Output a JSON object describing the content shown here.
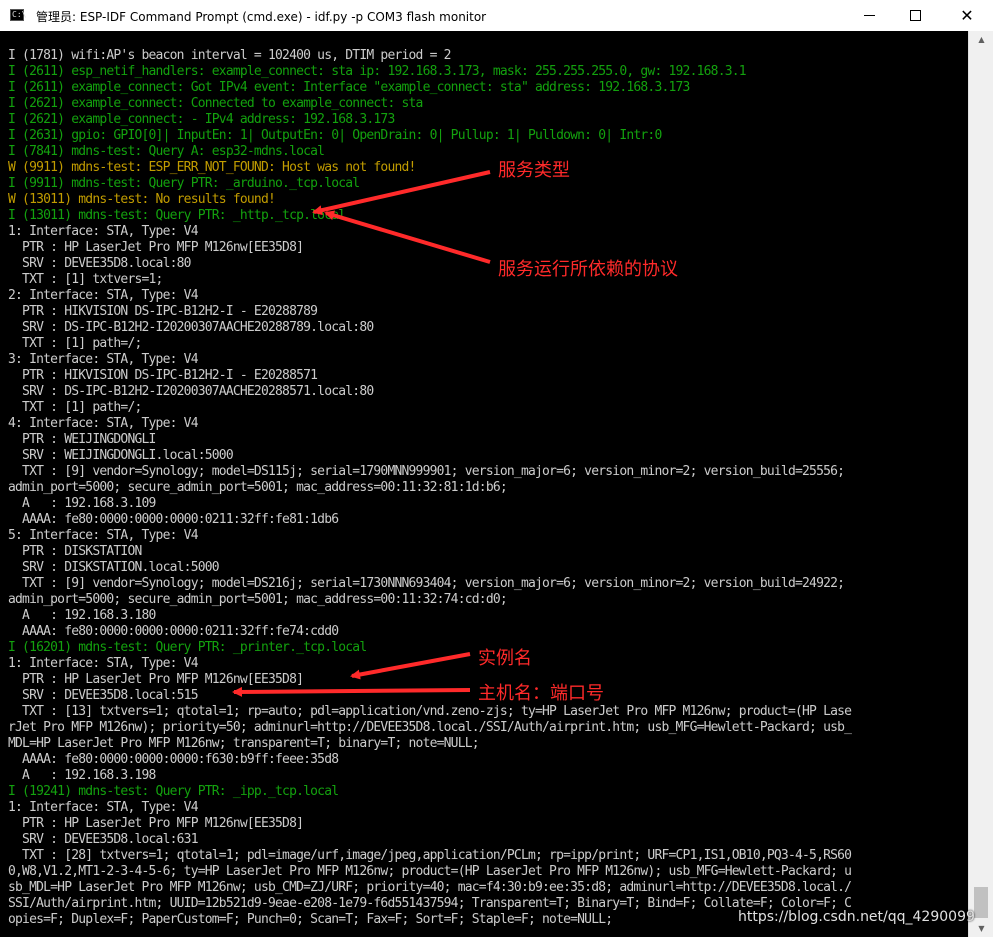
{
  "window": {
    "icon_text": "C:\\",
    "title": "管理员: ESP-IDF Command Prompt (cmd.exe) - idf.py  -p COM3 flash monitor",
    "close_label": "✕"
  },
  "scrollbar": {
    "up_arrow": "▲",
    "down_arrow": "▼"
  },
  "colors": {
    "green": "#13a10e",
    "yellow": "#c19c00",
    "plain": "#cccccc",
    "annotation": "#ff2a2a"
  },
  "console_lines": [
    {
      "style": "plain",
      "text": "I (1781) wifi:AP's beacon interval = 102400 us, DTIM period = 2"
    },
    {
      "style": "green",
      "text": "I (2611) esp_netif_handlers: example_connect: sta ip: 192.168.3.173, mask: 255.255.255.0, gw: 192.168.3.1"
    },
    {
      "style": "green",
      "text": "I (2611) example_connect: Got IPv4 event: Interface \"example_connect: sta\" address: 192.168.3.173"
    },
    {
      "style": "green",
      "text": "I (2621) example_connect: Connected to example_connect: sta"
    },
    {
      "style": "green",
      "text": "I (2621) example_connect: - IPv4 address: 192.168.3.173"
    },
    {
      "style": "green",
      "text": "I (2631) gpio: GPIO[0]| InputEn: 1| OutputEn: 0| OpenDrain: 0| Pullup: 1| Pulldown: 0| Intr:0"
    },
    {
      "style": "green",
      "text": "I (7841) mdns-test: Query A: esp32-mdns.local"
    },
    {
      "style": "yellow",
      "text": "W (9911) mdns-test: ESP_ERR_NOT_FOUND: Host was not found!"
    },
    {
      "style": "green",
      "text": "I (9911) mdns-test: Query PTR: _arduino._tcp.local"
    },
    {
      "style": "yellow",
      "text": "W (13011) mdns-test: No results found!"
    },
    {
      "style": "green",
      "text": "I (13011) mdns-test: Query PTR: _http._tcp.local"
    },
    {
      "style": "plain",
      "text": "1: Interface: STA, Type: V4"
    },
    {
      "style": "plain",
      "text": "  PTR : HP LaserJet Pro MFP M126nw[EE35D8]"
    },
    {
      "style": "plain",
      "text": "  SRV : DEVEE35D8.local:80"
    },
    {
      "style": "plain",
      "text": "  TXT : [1] txtvers=1;"
    },
    {
      "style": "plain",
      "text": "2: Interface: STA, Type: V4"
    },
    {
      "style": "plain",
      "text": "  PTR : HIKVISION DS-IPC-B12H2-I - E20288789"
    },
    {
      "style": "plain",
      "text": "  SRV : DS-IPC-B12H2-I20200307AACHE20288789.local:80"
    },
    {
      "style": "plain",
      "text": "  TXT : [1] path=/;"
    },
    {
      "style": "plain",
      "text": "3: Interface: STA, Type: V4"
    },
    {
      "style": "plain",
      "text": "  PTR : HIKVISION DS-IPC-B12H2-I - E20288571"
    },
    {
      "style": "plain",
      "text": "  SRV : DS-IPC-B12H2-I20200307AACHE20288571.local:80"
    },
    {
      "style": "plain",
      "text": "  TXT : [1] path=/;"
    },
    {
      "style": "plain",
      "text": "4: Interface: STA, Type: V4"
    },
    {
      "style": "plain",
      "text": "  PTR : WEIJINGDONGLI"
    },
    {
      "style": "plain",
      "text": "  SRV : WEIJINGDONGLI.local:5000"
    },
    {
      "style": "plain",
      "text": "  TXT : [9] vendor=Synology; model=DS115j; serial=1790MNN999901; version_major=6; version_minor=2; version_build=25556;"
    },
    {
      "style": "plain",
      "text": "admin_port=5000; secure_admin_port=5001; mac_address=00:11:32:81:1d:b6;"
    },
    {
      "style": "plain",
      "text": "  A   : 192.168.3.109"
    },
    {
      "style": "plain",
      "text": "  AAAA: fe80:0000:0000:0000:0211:32ff:fe81:1db6"
    },
    {
      "style": "plain",
      "text": "5: Interface: STA, Type: V4"
    },
    {
      "style": "plain",
      "text": "  PTR : DISKSTATION"
    },
    {
      "style": "plain",
      "text": "  SRV : DISKSTATION.local:5000"
    },
    {
      "style": "plain",
      "text": "  TXT : [9] vendor=Synology; model=DS216j; serial=1730NNN693404; version_major=6; version_minor=2; version_build=24922;"
    },
    {
      "style": "plain",
      "text": "admin_port=5000; secure_admin_port=5001; mac_address=00:11:32:74:cd:d0;"
    },
    {
      "style": "plain",
      "text": "  A   : 192.168.3.180"
    },
    {
      "style": "plain",
      "text": "  AAAA: fe80:0000:0000:0000:0211:32ff:fe74:cdd0"
    },
    {
      "style": "green",
      "text": "I (16201) mdns-test: Query PTR: _printer._tcp.local"
    },
    {
      "style": "plain",
      "text": "1: Interface: STA, Type: V4"
    },
    {
      "style": "plain",
      "text": "  PTR : HP LaserJet Pro MFP M126nw[EE35D8]"
    },
    {
      "style": "plain",
      "text": "  SRV : DEVEE35D8.local:515"
    },
    {
      "style": "plain",
      "text": "  TXT : [13] txtvers=1; qtotal=1; rp=auto; pdl=application/vnd.zeno-zjs; ty=HP LaserJet Pro MFP M126nw; product=(HP Lase"
    },
    {
      "style": "plain",
      "text": "rJet Pro MFP M126nw); priority=50; adminurl=http://DEVEE35D8.local./SSI/Auth/airprint.htm; usb_MFG=Hewlett-Packard; usb_"
    },
    {
      "style": "plain",
      "text": "MDL=HP LaserJet Pro MFP M126nw; transparent=T; binary=T; note=NULL;"
    },
    {
      "style": "plain",
      "text": "  AAAA: fe80:0000:0000:0000:f630:b9ff:feee:35d8"
    },
    {
      "style": "plain",
      "text": "  A   : 192.168.3.198"
    },
    {
      "style": "green",
      "text": "I (19241) mdns-test: Query PTR: _ipp._tcp.local"
    },
    {
      "style": "plain",
      "text": "1: Interface: STA, Type: V4"
    },
    {
      "style": "plain",
      "text": "  PTR : HP LaserJet Pro MFP M126nw[EE35D8]"
    },
    {
      "style": "plain",
      "text": "  SRV : DEVEE35D8.local:631"
    },
    {
      "style": "plain",
      "text": "  TXT : [28] txtvers=1; qtotal=1; pdl=image/urf,image/jpeg,application/PCLm; rp=ipp/print; URF=CP1,IS1,OB10,PQ3-4-5,RS60"
    },
    {
      "style": "plain",
      "text": "0,W8,V1.2,MT1-2-3-4-5-6; ty=HP LaserJet Pro MFP M126nw; product=(HP LaserJet Pro MFP M126nw); usb_MFG=Hewlett-Packard; u"
    },
    {
      "style": "plain",
      "text": "sb_MDL=HP LaserJet Pro MFP M126nw; usb_CMD=ZJ/URF; priority=40; mac=f4:30:b9:ee:35:d8; adminurl=http://DEVEE35D8.local./"
    },
    {
      "style": "plain",
      "text": "SSI/Auth/airprint.htm; UUID=12b521d9-9eae-e208-1e79-f6d551437594; Transparent=T; Binary=T; Bind=F; Collate=F; Color=F; C"
    },
    {
      "style": "plain",
      "text": "opies=F; Duplex=F; PaperCustom=F; Punch=0; Scan=T; Fax=F; Sort=F; Staple=F; note=NULL;"
    }
  ],
  "annotations": {
    "service_type": "服务类型",
    "protocol": "服务运行所依赖的协议",
    "instance_name": "实例名",
    "host_port": "主机名：端口号"
  },
  "watermark": "https://blog.csdn.net/qq_4290099"
}
